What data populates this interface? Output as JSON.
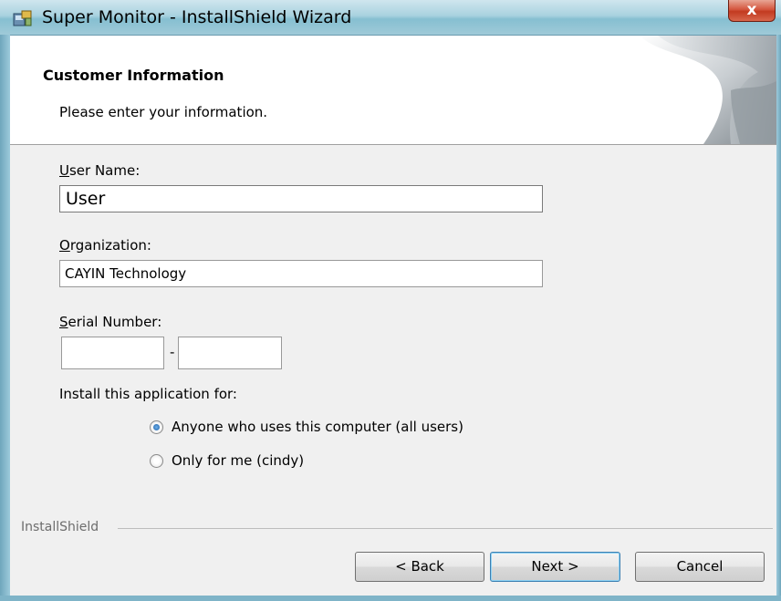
{
  "window": {
    "title": "Super Monitor - InstallShield Wizard",
    "close_glyph": "x"
  },
  "header": {
    "title": "Customer Information",
    "subtitle": "Please enter your information."
  },
  "form": {
    "user_name": {
      "label_accel": "U",
      "label_rest": "ser Name:",
      "value": "User"
    },
    "organization": {
      "label_accel": "O",
      "label_rest": "rganization:",
      "value": "CAYIN Technology"
    },
    "serial": {
      "label_accel": "S",
      "label_rest": "erial Number:",
      "part1": "",
      "separator": "-",
      "part2": ""
    },
    "install_for_label": "Install this application for:",
    "options": [
      {
        "label": "Anyone who uses this computer (all users)",
        "selected": true
      },
      {
        "label": "Only for me (cindy)",
        "selected": false
      }
    ]
  },
  "footer": {
    "brand": "InstallShield",
    "back_label": "< Back",
    "next_label": "Next >",
    "cancel_label": "Cancel"
  }
}
